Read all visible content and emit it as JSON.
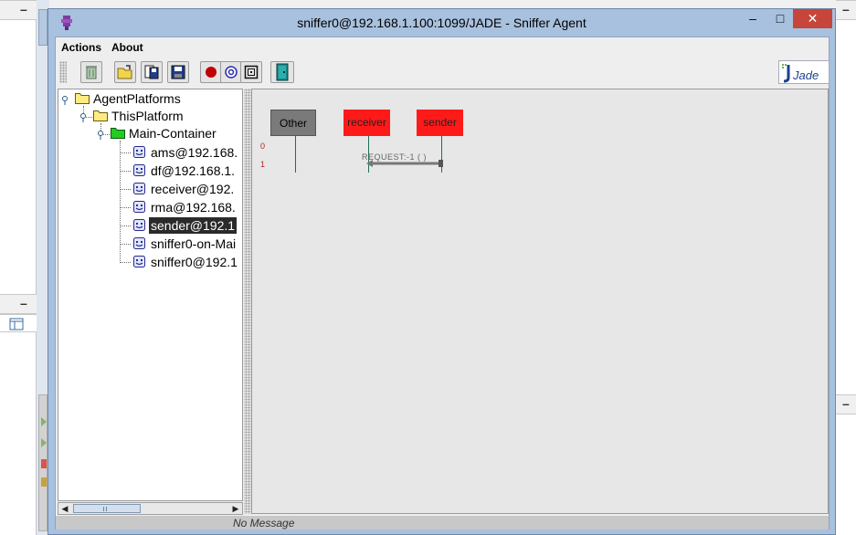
{
  "window": {
    "title": "sniffer0@192.168.1.100:1099/JADE - Sniffer Agent",
    "minimize": "–",
    "maximize": "□",
    "close": "✕"
  },
  "menu": {
    "actions": "Actions",
    "about": "About"
  },
  "toolbar": {
    "buttons": [
      "trash-icon",
      "open-folder-icon",
      "save-as-icon",
      "save-icon",
      "record-icon",
      "message-icon",
      "filter-icon",
      "exit-door-icon"
    ],
    "logo_text": "Jade"
  },
  "tree": {
    "root": "AgentPlatforms",
    "platform": "ThisPlatform",
    "container": "Main-Container",
    "agents": [
      "ams@192.168.",
      "df@192.168.1.",
      "receiver@192.",
      "rma@192.168.",
      "sender@192.1",
      "sniffer0-on-Mai",
      "sniffer0@192.1"
    ],
    "selected_index": 4
  },
  "diagram": {
    "agents": [
      "Other",
      "receiver",
      "sender"
    ],
    "rows": [
      "0",
      "1"
    ],
    "message": "REQUEST:-1 (      )"
  },
  "status": {
    "text": "No Message"
  },
  "colors": {
    "agent_active": "#ff1a1a",
    "agent_other": "#7a7a7a",
    "title_bar": "#a7c1de",
    "close_button": "#c7453a"
  }
}
